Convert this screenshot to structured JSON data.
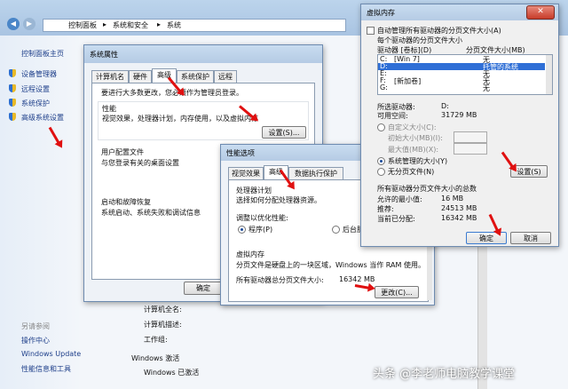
{
  "explorer": {
    "breadcrumb": [
      "控制面板",
      "系统和安全",
      "系统"
    ],
    "sidebar_home": "控制面板主页",
    "sidebar_items": [
      "设备管理器",
      "远程设置",
      "系统保护",
      "高级系统设置"
    ],
    "see_also": "另请参阅",
    "see_also_items": [
      "操作中心",
      "Windows Update",
      "性能信息和工具"
    ],
    "info_labels": [
      "计算机全名:",
      "计算机描述:",
      "工作组:"
    ],
    "activation_title": "Windows 激活",
    "activation_status": "Windows 已激活"
  },
  "sysprops": {
    "title": "系统属性",
    "tabs": [
      "计算机名",
      "硬件",
      "高级",
      "系统保护",
      "远程"
    ],
    "admin_note": "要进行大多数更改，您必须作为管理员登录。",
    "perf_title": "性能",
    "perf_desc": "视觉效果，处理器计划，内存使用，以及虚拟内存",
    "settings_btn": "设置(S)...",
    "profile_title": "用户配置文件",
    "profile_desc": "与您登录有关的桌面设置",
    "startup_title": "启动和故障恢复",
    "startup_desc": "系统启动、系统失败和调试信息",
    "ok_btn": "确定"
  },
  "perfopts": {
    "title": "性能选项",
    "tabs": [
      "视觉效果",
      "高级",
      "数据执行保护"
    ],
    "sched_title": "处理器计划",
    "sched_desc": "选择如何分配处理器资源。",
    "optimize_label": "调整以优化性能:",
    "opt_programs": "程序(P)",
    "opt_background": "后台服务(S)",
    "vm_title": "虚拟内存",
    "vm_desc": "分页文件是硬盘上的一块区域，Windows 当作 RAM 使用。",
    "vm_total_label": "所有驱动器总分页文件大小:",
    "vm_total_value": "16342 MB",
    "change_btn": "更改(C)..."
  },
  "vmem": {
    "title": "虚拟内存",
    "auto_manage": "自动管理所有驱动器的分页文件大小(A)",
    "per_drive_title": "每个驱动器的分页文件大小",
    "col_drive": "驱动器 [卷标](D)",
    "col_size": "分页文件大小(MB)",
    "drives": [
      {
        "drive": "C:",
        "label": "[Win 7]",
        "size": "无"
      },
      {
        "drive": "D:",
        "label": "",
        "size": "托管的系统"
      },
      {
        "drive": "E:",
        "label": "",
        "size": "无"
      },
      {
        "drive": "F:",
        "label": "[新加卷]",
        "size": "无"
      },
      {
        "drive": "G:",
        "label": "",
        "size": "无"
      }
    ],
    "selected_drive_label": "所选驱动器:",
    "selected_drive_value": "D:",
    "available_label": "可用空间:",
    "available_value": "31729 MB",
    "custom_size": "自定义大小(C):",
    "initial_size": "初始大小(MB)(I):",
    "max_size": "最大值(MB)(X):",
    "system_managed": "系统管理的大小(Y)",
    "no_paging": "无分页文件(N)",
    "set_btn": "设置(S)",
    "total_title": "所有驱动器分页文件大小的总数",
    "min_allowed_label": "允许的最小值:",
    "min_allowed_value": "16 MB",
    "recommended_label": "推荐:",
    "recommended_value": "24513 MB",
    "current_label": "当前已分配:",
    "current_value": "16342 MB",
    "ok_btn": "确定",
    "cancel_btn": "取消"
  },
  "watermark": "头条 @李老师电脑教学课堂",
  "colors": {
    "accent": "#2d6fd1",
    "annotation_arrow": "#e01010",
    "selection": "#2f6fd6"
  }
}
